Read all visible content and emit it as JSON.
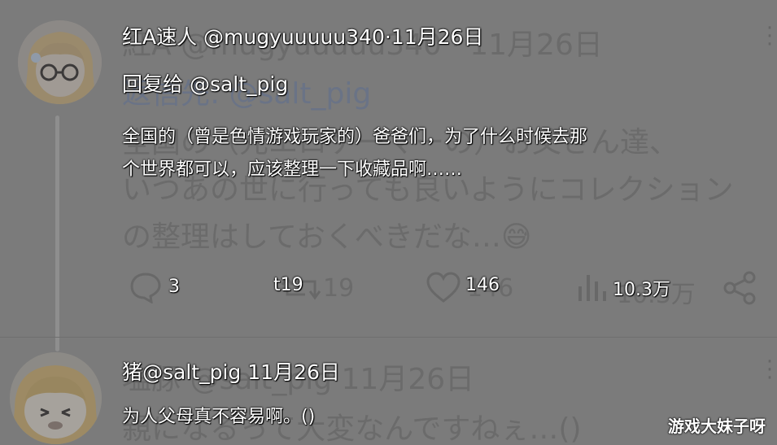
{
  "post1": {
    "ghost_header": "紅A  @mugyuuuuu340 · 11月26日",
    "ghost_reply": "返信先: @salt_pig",
    "ghost_body_line1": "全国の（元エロゲーマーの）お父さん達、",
    "ghost_body_line2": "いつあの世に行っても良いようにコレクション",
    "ghost_body_line3": "の整理はしておくべきだな…😅",
    "header": "红A速人 @mugyuuuuu340·11月26日",
    "reply_to": "回复给 @salt_pig",
    "body_line1": "全国的（曾是色情游戏玩家的）爸爸们，为了什么时候去那",
    "body_line2": "个世界都可以，应该整理一下收藏品啊……",
    "actions": {
      "reply_count": "3",
      "retweet_count_ghost": "19",
      "retweet_count": "t19",
      "like_count_ghost": "146",
      "like_count": "146",
      "views_ghost": "10.3万",
      "views": "10.3万"
    }
  },
  "post2": {
    "ghost_header": "塩豚 @salt_pig 11月26日",
    "ghost_body": "親になるって大変なんですねぇ…()",
    "header": "猪@salt_pig 11月26日",
    "body": "为人父母真不容易啊。()"
  },
  "watermark": "游戏大妹子呀"
}
